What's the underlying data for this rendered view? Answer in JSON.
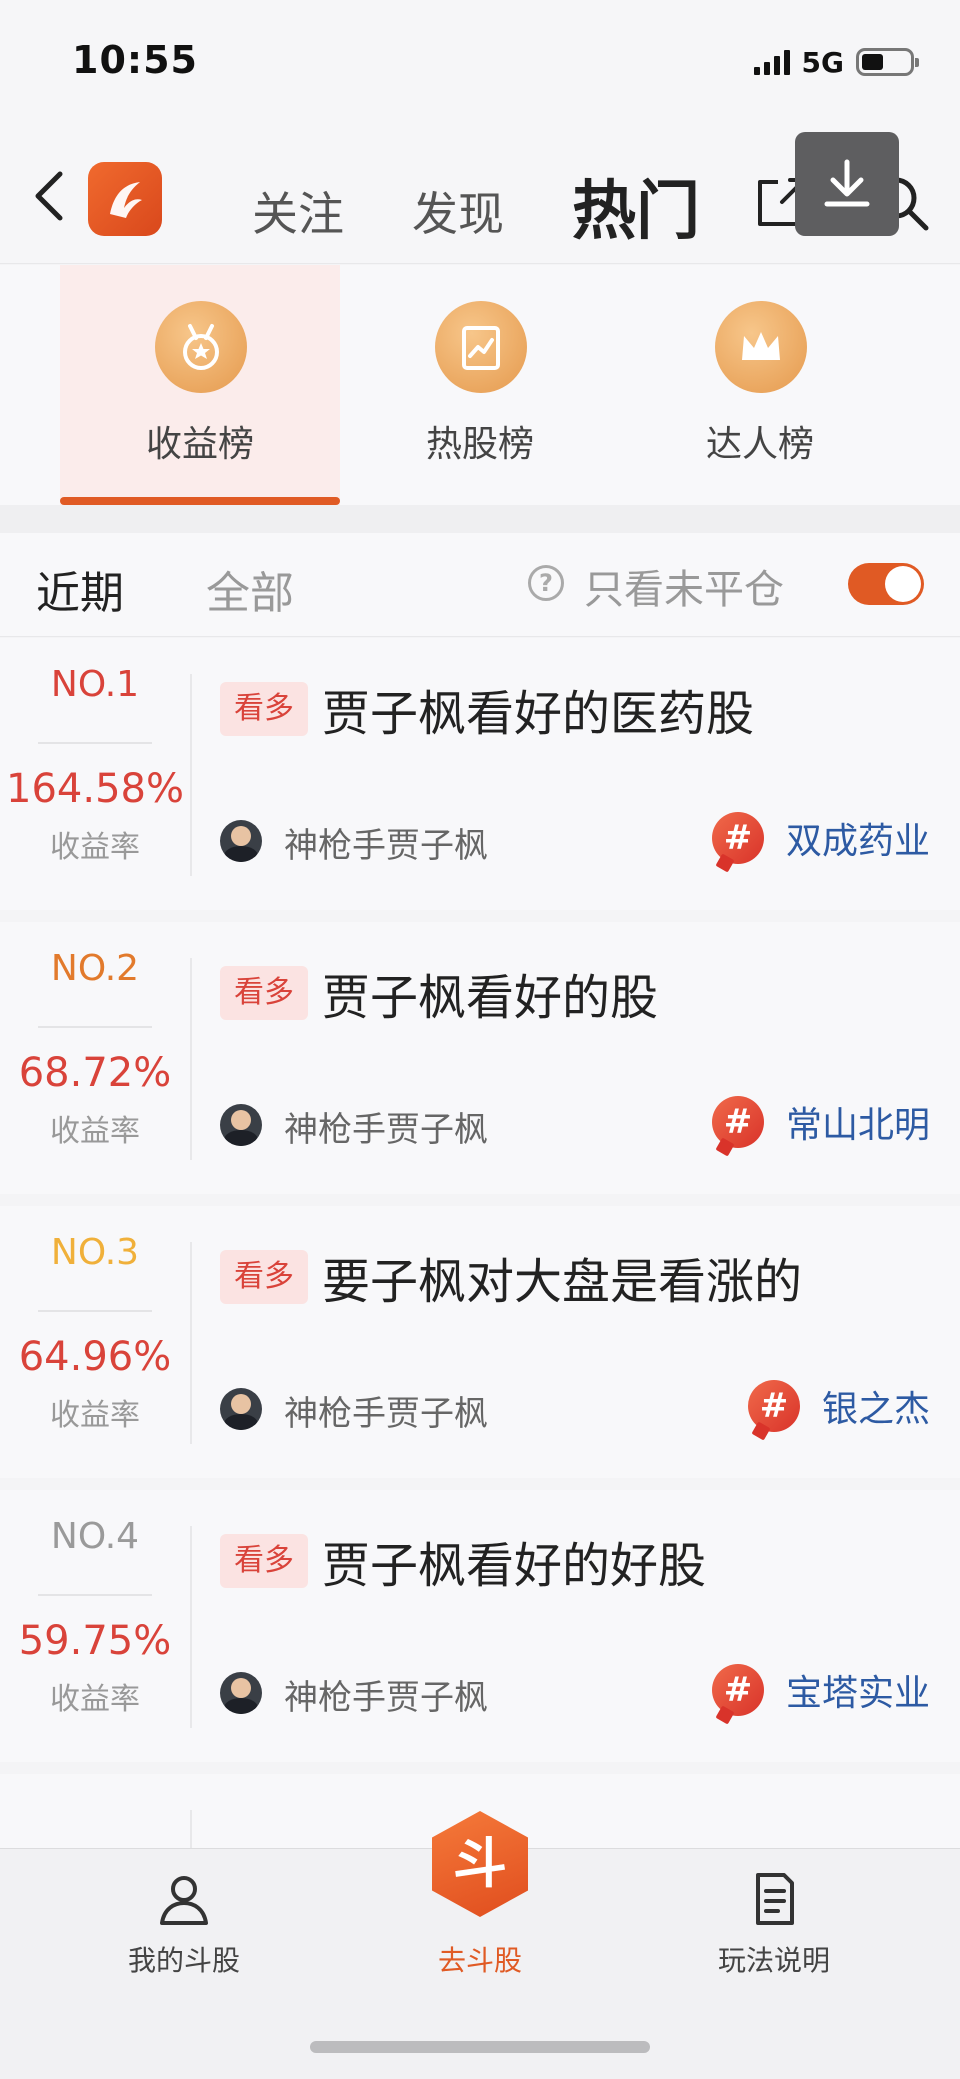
{
  "status_bar": {
    "time": "10:55",
    "network": "5G"
  },
  "top_nav": {
    "tabs": [
      {
        "label": "关注"
      },
      {
        "label": "发现"
      },
      {
        "label": "热门"
      }
    ]
  },
  "categories": [
    {
      "label": "收益榜",
      "icon": "medal-icon"
    },
    {
      "label": "热股榜",
      "icon": "trend-chart-icon"
    },
    {
      "label": "达人榜",
      "icon": "crown-icon"
    }
  ],
  "filter": {
    "tabs": [
      {
        "label": "近期"
      },
      {
        "label": "全部"
      }
    ],
    "only_open_label": "只看未平仓",
    "only_open_enabled": true
  },
  "rank_list": [
    {
      "rank": "NO.1",
      "rank_color": "#d9433a",
      "rate": "164.58%",
      "rate_label": "收益率",
      "tag": "看多",
      "title": "贾子枫看好的医药股",
      "user": "神枪手贾子枫",
      "stock": "双成药业"
    },
    {
      "rank": "NO.2",
      "rank_color": "#e27a2c",
      "rate": "68.72%",
      "rate_label": "收益率",
      "tag": "看多",
      "title": "贾子枫看好的股",
      "user": "神枪手贾子枫",
      "stock": "常山北明"
    },
    {
      "rank": "NO.3",
      "rank_color": "#f0b03a",
      "rate": "64.96%",
      "rate_label": "收益率",
      "tag": "看多",
      "title": "要子枫对大盘是看涨的",
      "user": "神枪手贾子枫",
      "stock": "银之杰"
    },
    {
      "rank": "NO.4",
      "rank_color": "#9a9a9a",
      "rate": "59.75%",
      "rate_label": "收益率",
      "tag": "看多",
      "title": "贾子枫看好的好股",
      "user": "神枪手贾子枫",
      "stock": "宝塔实业"
    }
  ],
  "bottom_bar": {
    "items": [
      {
        "label": "我的斗股",
        "icon": "user-icon"
      },
      {
        "label": "去斗股",
        "icon": "dou-badge-icon",
        "badge_text": "斗"
      },
      {
        "label": "玩法说明",
        "icon": "document-icon"
      }
    ]
  },
  "colors": {
    "accent": "#e05a24",
    "rate_red": "#d9433a",
    "stock_blue": "#2d5aa3"
  }
}
